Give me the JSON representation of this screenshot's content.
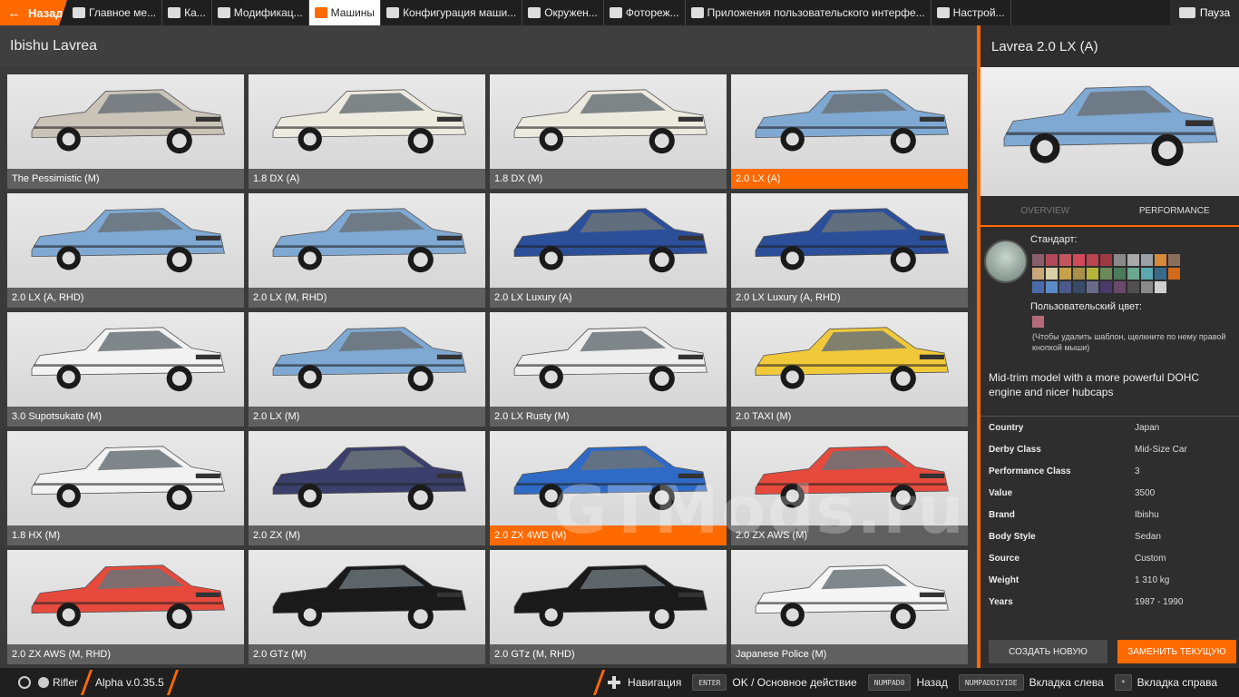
{
  "topbar": {
    "back_label": "Назад",
    "tabs": [
      {
        "label": "Главное ме...",
        "icon": "home-icon"
      },
      {
        "label": "Ка...",
        "icon": "map-icon"
      },
      {
        "label": "Модификац...",
        "icon": "puzzle-icon"
      },
      {
        "label": "Машины",
        "icon": "car-icon"
      },
      {
        "label": "Конфигурация маши...",
        "icon": "engine-icon"
      },
      {
        "label": "Окружен...",
        "icon": "weather-icon"
      },
      {
        "label": "Фотореж...",
        "icon": "camera-icon"
      },
      {
        "label": "Приложения пользовательского интерфе...",
        "icon": "apps-icon"
      },
      {
        "label": "Настрой...",
        "icon": "sliders-icon"
      }
    ],
    "pause_label": "Пауза"
  },
  "left_header": {
    "title": "Ibishu Lavrea"
  },
  "vehicles": [
    {
      "label": "The Pessimistic (M)",
      "body": "#c9c3b8",
      "selected": false
    },
    {
      "label": "1.8 DX (A)",
      "body": "#ece9df",
      "selected": false
    },
    {
      "label": "1.8 DX (M)",
      "body": "#ece9df",
      "selected": false
    },
    {
      "label": "2.0 LX (A)",
      "body": "#7fa9d3",
      "selected": true
    },
    {
      "label": "2.0 LX (A, RHD)",
      "body": "#7fa9d3",
      "selected": false
    },
    {
      "label": "2.0 LX (M, RHD)",
      "body": "#7fa9d3",
      "selected": false
    },
    {
      "label": "2.0 LX Luxury (A)",
      "body": "#2c4f9a",
      "selected": false
    },
    {
      "label": "2.0 LX Luxury (A, RHD)",
      "body": "#2c4f9a",
      "selected": false
    },
    {
      "label": "3.0 Supotsukato (M)",
      "body": "#f2f2f2",
      "selected": false
    },
    {
      "label": "2.0 LX (M)",
      "body": "#7fa9d3",
      "selected": false
    },
    {
      "label": "2.0 LX Rusty (M)",
      "body": "#ededed",
      "selected": false
    },
    {
      "label": "2.0 TAXI (M)",
      "body": "#f0c93a",
      "selected": false
    },
    {
      "label": "1.8 HX (M)",
      "body": "#f2f2f2",
      "selected": false
    },
    {
      "label": "2.0 ZX (M)",
      "body": "#3a3f6b",
      "selected": false
    },
    {
      "label": "2.0 ZX 4WD (M)",
      "body": "#2f6bc6",
      "selected": true
    },
    {
      "label": "2.0 ZX AWS (M)",
      "body": "#e64a3c",
      "selected": false
    },
    {
      "label": "2.0 ZX AWS (M, RHD)",
      "body": "#e64a3c",
      "selected": false
    },
    {
      "label": "2.0 GTz (M)",
      "body": "#1a1a1a",
      "selected": false
    },
    {
      "label": "2.0 GTz (M, RHD)",
      "body": "#1a1a1a",
      "selected": false
    },
    {
      "label": "Japanese Police (M)",
      "body": "#f5f5f5",
      "selected": false
    }
  ],
  "right_panel": {
    "title": "Lavrea 2.0 LX (A)",
    "preview_body": "#7fa9d3",
    "tabs": [
      {
        "label": "OVERVIEW",
        "active": false
      },
      {
        "label": "PERFORMANCE",
        "active": true
      }
    ],
    "paint_standard_label": "Стандарт:",
    "paint_custom_label": "Пользовательский цвет:",
    "paint_hint": "(Чтобы удалить шаблон, щелкните по нему правой кнопкой мыши)",
    "swatches": [
      "#8a5e6a",
      "#b04a5a",
      "#c45560",
      "#d24a5a",
      "#b9454f",
      "#9e3a44",
      "#8a8a8a",
      "#a8a8a8",
      "#9aa0a6",
      "#d68a3a",
      "#8a6f5a",
      "#c9a77a",
      "#d8cfa8",
      "#c8a24a",
      "#a8904a",
      "#b5b53a",
      "#6a8a5a",
      "#4a7a5a",
      "#6aa890",
      "#5aa8b0",
      "#3a6a8a",
      "#d46a1a",
      "#4a6aa8",
      "#5a8ac8",
      "#4a5a8a",
      "#3a4a6a",
      "#6a6a8a",
      "#4a3a6a",
      "#6a4a6a",
      "#505050",
      "#8a8a8a",
      "#d0d0d0"
    ],
    "custom_swatch": "#b56a78",
    "description": "Mid-trim model with a more powerful DOHC engine and nicer hubcaps",
    "specs": [
      {
        "key": "Country",
        "value": "Japan"
      },
      {
        "key": "Derby Class",
        "value": "Mid-Size Car"
      },
      {
        "key": "Performance Class",
        "value": "3"
      },
      {
        "key": "Value",
        "value": "3500"
      },
      {
        "key": "Brand",
        "value": "Ibishu"
      },
      {
        "key": "Body Style",
        "value": "Sedan"
      },
      {
        "key": "Source",
        "value": "Custom"
      },
      {
        "key": "Weight",
        "value": "1 310 kg"
      },
      {
        "key": "Years",
        "value": "1987 - 1990"
      }
    ],
    "btn_new": "СОЗДАТЬ НОВУЮ",
    "btn_replace": "ЗАМЕНИТЬ ТЕКУЩУЮ"
  },
  "bottombar": {
    "user": "Rifler",
    "version": "Alpha v.0.35.5",
    "nav_label": "Навигация",
    "hints": [
      {
        "key": "ENTER",
        "action": "OK / Основное действие"
      },
      {
        "key": "NUMPAD0",
        "action": "Назад"
      },
      {
        "key": "NUMPADDIVIDE",
        "action": "Вкладка слева"
      },
      {
        "key": "*",
        "action": "Вкладка справа"
      }
    ]
  },
  "watermark": "GTMods.ru",
  "colors": {
    "accent": "#ff6a00"
  }
}
